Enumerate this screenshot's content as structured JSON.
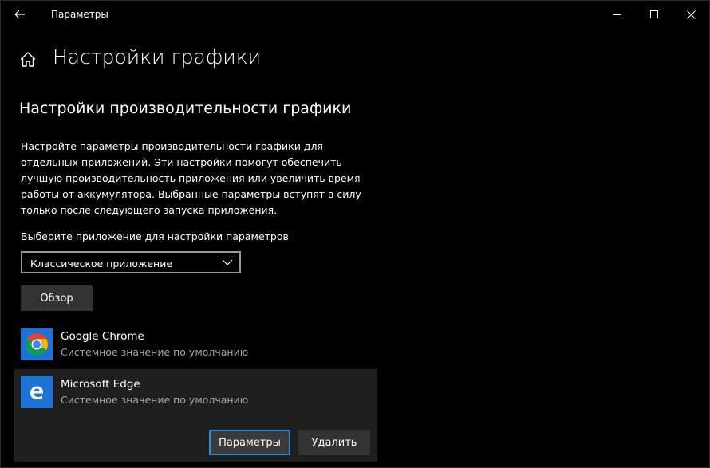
{
  "window": {
    "title": "Параметры"
  },
  "header": {
    "page_title": "Настройки графики",
    "section_title": "Настройки производительности графики"
  },
  "description": "Настройте параметры производительности графики для отдельных приложений. Эти настройки помогут обеспечить лучшую производительность приложения или увеличить время работы от аккумулятора. Выбранные параметры вступят в силу только после следующего запуска приложения.",
  "app_select": {
    "label": "Выберите приложение для настройки параметров",
    "value": "Классическое приложение"
  },
  "browse_label": "Обзор",
  "apps": [
    {
      "name": "Google Chrome",
      "status": "Системное значение по умолчанию",
      "icon": "chrome-icon"
    },
    {
      "name": "Microsoft Edge",
      "status": "Системное значение по умолчанию",
      "icon": "edge-icon",
      "options_label": "Параметры",
      "delete_label": "Удалить"
    }
  ],
  "colors": {
    "background": "#000000",
    "accent": "#1b73d6",
    "focus_border": "#2a8ad4",
    "button": "#333333",
    "selected_row": "#1f1f1f",
    "secondary_text": "#a6a6a6"
  }
}
